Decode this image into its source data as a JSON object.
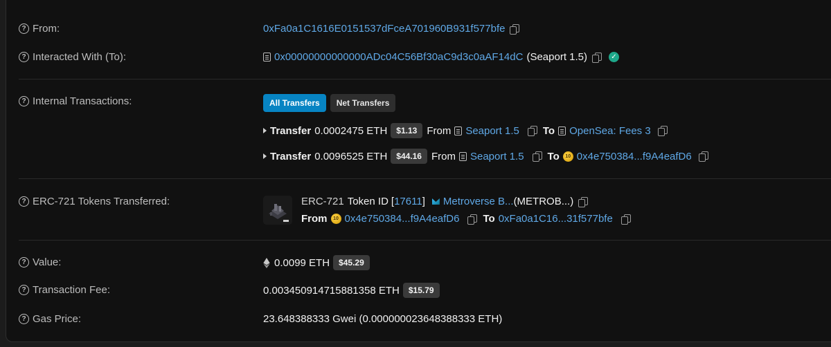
{
  "rows": {
    "from": {
      "label": "From:",
      "address": "0xFa0a1C1616E0151537dFceA701960B931f577bfe"
    },
    "to": {
      "label": "Interacted With (To):",
      "address": "0x00000000000000ADc04C56Bf30aC9d3c0aAF14dC",
      "name": "(Seaport 1.5)"
    },
    "internal": {
      "label": "Internal Transactions:",
      "tabs": [
        "All Transfers",
        "Net Transfers"
      ],
      "transfers": [
        {
          "prefix": "Transfer",
          "amount": "0.0002475 ETH",
          "usd": "$1.13",
          "from_word": "From",
          "from": "Seaport 1.5",
          "to_word": "To",
          "to": "OpenSea: Fees 3"
        },
        {
          "prefix": "Transfer",
          "amount": "0.0096525 ETH",
          "usd": "$44.16",
          "from_word": "From",
          "from": "Seaport 1.5",
          "to_word": "To",
          "to": "0x4e750384...f9A4eafD6"
        }
      ]
    },
    "erc721": {
      "label": "ERC-721 Tokens Transferred:",
      "token_standard": "ERC-721",
      "token_id_label": "Token ID",
      "bracket_open": "[",
      "token_id": "17611",
      "bracket_close": "]",
      "collection": "Metroverse B...",
      "symbol": "(METROB...)",
      "from_word": "From",
      "from": "0x4e750384...f9A4eafD6",
      "to_word": "To",
      "to": "0xFa0a1C16...31f577bfe"
    },
    "value": {
      "label": "Value:",
      "amount": "0.0099 ETH",
      "usd": "$45.29"
    },
    "fee": {
      "label": "Transaction Fee:",
      "amount": "0.003450914715881358 ETH",
      "usd": "$15.79"
    },
    "gas": {
      "label": "Gas Price:",
      "amount": "23.648388333 Gwei (0.000000023648388333 ETH)"
    }
  },
  "colors": {
    "link": "#5fa8e6",
    "accent": "#0784c3",
    "verified": "#1ea78a"
  }
}
